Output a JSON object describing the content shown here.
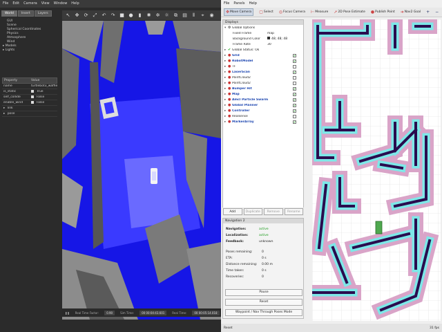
{
  "gazebo": {
    "menu": [
      "File",
      "Edit",
      "Camera",
      "View",
      "Window",
      "Help"
    ],
    "tabs": [
      {
        "label": "World",
        "active": true
      },
      {
        "label": "Insert",
        "active": false
      },
      {
        "label": "Layers",
        "active": false
      }
    ],
    "world_items": [
      "GUI",
      "Scene",
      "Spherical Coordinates",
      "Physics",
      "Atmosphere",
      "Wind"
    ],
    "world_groups": [
      "Models",
      "Lights"
    ],
    "property_header": {
      "property": "Property",
      "value": "Value"
    },
    "properties": [
      {
        "name": "name",
        "value": "turtlebot3_waffle"
      },
      {
        "name": "is_static",
        "value": "True"
      },
      {
        "name": "self_collide",
        "value": "False"
      },
      {
        "name": "enable_wind",
        "value": "False"
      }
    ],
    "property_groups": [
      "link",
      "pose"
    ],
    "bottom": {
      "real_time_factor_label": "Real Time Factor:",
      "real_time_factor": "0.90",
      "sim_time_label": "Sim Time:",
      "sim_time": "00 00:04:43.601",
      "real_time_label": "Real Time:",
      "real_time": "00 00:05:14.018"
    }
  },
  "rviz": {
    "menu": [
      "File",
      "Panels",
      "Help"
    ],
    "tools": [
      {
        "label": "Move Camera",
        "icon": "move-camera-icon",
        "active": true
      },
      {
        "label": "Select",
        "icon": "select-icon",
        "active": false
      },
      {
        "label": "Focus Camera",
        "icon": "focus-camera-icon",
        "active": false
      },
      {
        "label": "Measure",
        "icon": "measure-icon",
        "active": false
      },
      {
        "label": "2D Pose Estimate",
        "icon": "pose-estimate-icon",
        "active": false
      },
      {
        "label": "Publish Point",
        "icon": "publish-point-icon",
        "active": false
      },
      {
        "label": "Nav2 Goal",
        "icon": "nav2-goal-icon",
        "active": false
      }
    ],
    "displays": {
      "title": "Displays",
      "global_options": "Global Options",
      "options": [
        {
          "name": "Fixed Frame",
          "value": "map"
        },
        {
          "name": "Background Color",
          "value": "48; 48; 48"
        },
        {
          "name": "Frame Rate",
          "value": "30"
        }
      ],
      "global_status": "Global Status: Ok",
      "items": [
        {
          "name": "Grid",
          "checked": true
        },
        {
          "name": "RobotModel",
          "checked": true
        },
        {
          "name": "TF",
          "checked": false
        },
        {
          "name": "LaserScan",
          "checked": true
        },
        {
          "name": "PointCloud2",
          "checked": false
        },
        {
          "name": "PointCloud2",
          "checked": false
        },
        {
          "name": "Bumper Hit",
          "checked": true
        },
        {
          "name": "Map",
          "checked": true
        },
        {
          "name": "Amcl Particle Swarm",
          "checked": true
        },
        {
          "name": "Global Planner",
          "checked": true
        },
        {
          "name": "Controller",
          "checked": true
        },
        {
          "name": "Realsense",
          "checked": false
        },
        {
          "name": "MarkerArray",
          "checked": true
        }
      ],
      "buttons": {
        "add": "Add",
        "duplicate": "Duplicate",
        "remove": "Remove",
        "rename": "Rename"
      }
    },
    "navigation": {
      "title": "Navigation 2",
      "navigation_label": "Navigation:",
      "navigation": "active",
      "localization_label": "Localization:",
      "localization": "active",
      "feedback_label": "Feedback:",
      "feedback": "unknown",
      "stats": [
        {
          "name": "Poses remaining:",
          "value": "0"
        },
        {
          "name": "ETA:",
          "value": "0 s"
        },
        {
          "name": "Distance remaining:",
          "value": "0.00 m"
        },
        {
          "name": "Time taken:",
          "value": "0 s"
        },
        {
          "name": "Recoveries:",
          "value": "0"
        }
      ],
      "pause_button": "Pause",
      "reset_button": "Reset",
      "waypoint_button": "Waypoint / Nav Through Poses Mode"
    },
    "status": {
      "reset": "Reset",
      "fps": "31 fps"
    },
    "colors": {
      "costmap_outer": "#d9a4c8",
      "costmap_inner": "#7de8e8",
      "obstacle": "#2a0c4e",
      "robot": "#4ea84e"
    }
  }
}
